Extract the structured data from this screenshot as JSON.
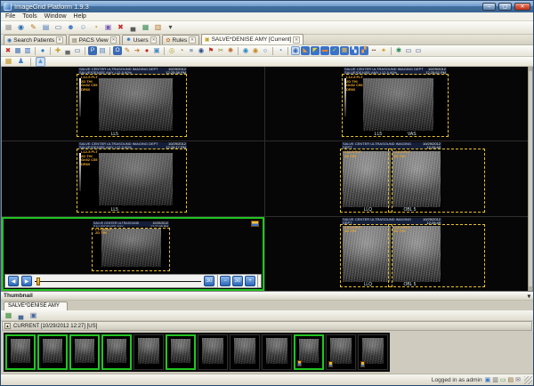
{
  "window": {
    "title": "ImageGrid Platform 1.9.3",
    "minimize": "–",
    "maximize": "▢",
    "close": "✕"
  },
  "menu": {
    "items": [
      {
        "name": "menu-file",
        "label": "File"
      },
      {
        "name": "menu-tools",
        "label": "Tools"
      },
      {
        "name": "menu-window",
        "label": "Window"
      },
      {
        "name": "menu-help",
        "label": "Help"
      }
    ]
  },
  "toolbar_main": {
    "icons": [
      {
        "name": "select-icon",
        "glyph": "▦",
        "color": "#9a9a9a"
      },
      {
        "name": "search-patients-icon",
        "glyph": "◉",
        "color": "#2a6db5"
      },
      {
        "name": "edit-study-icon",
        "glyph": "✎",
        "color": "#b07818"
      },
      {
        "name": "import-study-icon",
        "glyph": "▤",
        "color": "#4a7ab5"
      },
      {
        "name": "pacs-monitor-icon",
        "glyph": "▭",
        "color": "#3a5a8a"
      },
      {
        "name": "user-group-icon",
        "glyph": "☻",
        "color": "#3a76c4"
      },
      {
        "name": "user-icon",
        "glyph": "☺",
        "color": "#6a9ad4"
      },
      {
        "name": "query-retrieve-icon",
        "glyph": "◔",
        "color": "#b5902a"
      },
      {
        "name": "archive-icon",
        "glyph": "▣",
        "color": "#7a5ab5"
      },
      {
        "name": "delete-icon",
        "glyph": "✖",
        "color": "#c42a2a"
      },
      {
        "name": "print-icon",
        "glyph": "▄",
        "color": "#5a5a5a"
      },
      {
        "name": "film-icon",
        "glyph": "▦",
        "color": "#3a8a5a"
      },
      {
        "name": "export-db-icon",
        "glyph": "▥",
        "color": "#b5762a"
      },
      {
        "name": "dropdown-caret-icon",
        "glyph": "▾",
        "color": "#444444"
      }
    ]
  },
  "tabs": {
    "close_glyph": "✕",
    "items": [
      {
        "name": "tab-search-patients",
        "label": "Search Patients",
        "glyph": "◉",
        "color": "#2a6db5"
      },
      {
        "name": "tab-pacs-view",
        "label": "PACS View",
        "glyph": "▤",
        "color": "#7a6a4a"
      },
      {
        "name": "tab-users",
        "label": "Users",
        "glyph": "☻",
        "color": "#3a76c4"
      },
      {
        "name": "tab-rules",
        "label": "Rules",
        "glyph": "✿",
        "color": "#c4702a"
      },
      {
        "name": "tab-study-salve-denise-amy",
        "label": "SALVE*DENISE AMY [Current]",
        "glyph": "▣",
        "color": "#c4a02a",
        "active": true
      }
    ]
  },
  "toolbar_view": {
    "icons": [
      {
        "name": "close-study-icon",
        "glyph": "✖",
        "color": "#c42a2a"
      },
      {
        "name": "layout-grid-icon",
        "glyph": "▦",
        "color": "#3a6ab4"
      },
      {
        "name": "layout-compare-icon",
        "glyph": "▥",
        "color": "#3a6ab4"
      },
      {
        "sep": true
      },
      {
        "name": "sphere-view-icon",
        "glyph": "●",
        "color": "#2a7ac4"
      },
      {
        "sep": true
      },
      {
        "name": "calibrate-icon",
        "glyph": "✚",
        "color": "#c4a02a"
      },
      {
        "name": "print-image-icon",
        "glyph": "▄",
        "color": "#6a6a6a"
      },
      {
        "name": "film-composer-icon",
        "glyph": "▭",
        "color": "#4a6a9a"
      },
      {
        "sep": true
      },
      {
        "name": "tag-p-icon",
        "glyph": "P",
        "color": "#ffffff",
        "bg": "#3a6ab4"
      },
      {
        "name": "page-icon",
        "glyph": "▤",
        "color": "#4a7ab5"
      },
      {
        "sep": true
      },
      {
        "name": "tag-o-icon",
        "glyph": "O",
        "color": "#ffffff",
        "bg": "#3a6ab4"
      },
      {
        "name": "annotate-icon",
        "glyph": "✎",
        "color": "#b07818"
      },
      {
        "name": "send-study-icon",
        "glyph": "➔",
        "color": "#c4701a"
      },
      {
        "name": "record-icon",
        "glyph": "●",
        "color": "#cc2222"
      },
      {
        "name": "copy-icon",
        "glyph": "▣",
        "color": "#4a8ac4"
      },
      {
        "sep": true
      },
      {
        "name": "burn-cd-icon",
        "glyph": "◎",
        "color": "#b5a02a"
      },
      {
        "name": "history-icon",
        "glyph": "◔",
        "color": "#8a7a2a"
      },
      {
        "name": "layers-icon",
        "glyph": "≡",
        "color": "#4a6a9a"
      },
      {
        "name": "find-icon",
        "glyph": "◉",
        "color": "#2a4a8a"
      },
      {
        "name": "flag-icon",
        "glyph": "⚑",
        "color": "#c42a2a"
      },
      {
        "name": "measure-icon",
        "glyph": "✂",
        "color": "#8a8a2a"
      },
      {
        "name": "palette-icon",
        "glyph": "✺",
        "color": "#c46a2a"
      },
      {
        "sep": true
      },
      {
        "name": "web-icon",
        "glyph": "◉",
        "color": "#2a8ac4"
      },
      {
        "name": "web-settings-icon",
        "glyph": "◉",
        "color": "#c48a2a"
      },
      {
        "name": "zoom-icon",
        "glyph": "○",
        "color": "#3a6ab4"
      },
      {
        "sep": true
      },
      {
        "name": "world-clock-icon",
        "glyph": "◔",
        "color": "#2a8ac4"
      },
      {
        "sep": true
      },
      {
        "name": "magnify-mode-icon",
        "glyph": "◉",
        "color": "#3a6ab4",
        "pressed": true
      },
      {
        "name": "preset-layout-1-icon",
        "glyph": "◣",
        "color": "#e8a23a",
        "bg": "#3a72c8"
      },
      {
        "name": "preset-layout-2-icon",
        "glyph": "◤",
        "color": "#e8d43a",
        "bg": "#3a72c8"
      },
      {
        "name": "preset-layout-3-icon",
        "glyph": "▬",
        "color": "#e8832a",
        "bg": "#3a72c8"
      },
      {
        "name": "preset-layout-4-icon",
        "glyph": "✓",
        "color": "#aef05a",
        "bg": "#3a72c8"
      },
      {
        "name": "preset-layout-5-icon",
        "glyph": "▦",
        "color": "#f0c04a",
        "bg": "#3a72c8"
      },
      {
        "name": "preset-layout-6-icon",
        "glyph": "▚",
        "color": "#f0f0f0",
        "bg": "#3a72c8"
      },
      {
        "name": "preset-layout-7-icon",
        "glyph": "▞",
        "color": "#f0a04a",
        "bg": "#3a72c8"
      },
      {
        "name": "ruler-icon",
        "glyph": "┅",
        "color": "#7a4a2a"
      },
      {
        "name": "key-icon",
        "glyph": "✦",
        "color": "#d4a02a"
      },
      {
        "sep": true
      },
      {
        "name": "tools-icon",
        "glyph": "✱",
        "color": "#2a8a5a"
      },
      {
        "name": "monitor-a-icon",
        "glyph": "▭",
        "color": "#4a6a9a"
      },
      {
        "name": "monitor-b-icon",
        "glyph": "▭",
        "color": "#4a6a9a"
      }
    ]
  },
  "toolbar_sub": {
    "icons": [
      {
        "name": "grid-tool-icon",
        "glyph": "▦",
        "color": "#c49a2a"
      },
      {
        "name": "stamp-tool-icon",
        "glyph": "♟",
        "color": "#3a7ac4"
      },
      {
        "sep": true
      },
      {
        "name": "prism-tool-icon",
        "glyph": "▲",
        "color": "#5a9ac4",
        "pressed": true
      }
    ]
  },
  "viewer": {
    "panels": [
      {
        "banner_left": "SALVE CENTER ULTRASOUND  IMAGING DEPT\nSALVE*DENISE AMY  L12-5  60%",
        "banner_right": "10/29/2012\n12:25:38 PM",
        "overlay": "L12-5 PLT\n2D THI\nGn52 C55\nDR60",
        "label": "LL5",
        "label2": ""
      },
      {
        "banner_left": "SALVE CENTER ULTRASOUND  IMAGING DEPT\nSALVE*DENISE AMY  L12-5  60%",
        "banner_right": "10/29/2012\n12:25:52 PM",
        "overlay": "L12-5 PLT\n2D THI\nGn52 C55\nDR60",
        "label": "LL5",
        "label2": "VAS"
      },
      {
        "banner_left": "SALVE CENTER ULTRASOUND  IMAGING DEPT\nSALVE*DENISE AMY  L12-5  60%",
        "banner_right": "10/29/2012\n12:26:17 PM",
        "overlay": "L12-5 PLT\n2D THI\nGn52 C55\nDR60",
        "label": "LL5",
        "label2": ""
      },
      {
        "banner_left": "SALVE CENTER ULTRASOUND  IMAGING DEPT\nSALVE*DENISE AMY  L12-5  60%",
        "banner_right": "10/29/2012\n12:26:40 PM",
        "overlay": "L12-5 PLT\n2D THI",
        "overlay2": "L12-5 PLT\n2D THI",
        "label": "LLQ",
        "label2": "OBL 5"
      },
      {
        "banner_left": "SALVE CENTER ULTRASOUND\nSALVE*DENISE AMY",
        "banner_right": "10/29/2012\n12:27:05 PM",
        "overlay": "L12-5 PLT\n2D THI",
        "label": "",
        "label2": ""
      },
      {
        "banner_left": "SALVE CENTER ULTRASOUND  IMAGING DEPT\nSALVE*DENISE AMY  L12-5  60%",
        "banner_right": "10/29/2012\n12:26:49 PM",
        "overlay": "L12-5 PLT\n2D THI",
        "overlay2": "L12-5 PLT\n2D THI",
        "label": "LLQ",
        "label2": "OBL 5"
      }
    ],
    "player": {
      "prev": "◀",
      "play": "▶",
      "fps": "30",
      "minus": "−",
      "fps2": "30",
      "plus": "+"
    }
  },
  "thumbnail_panel": {
    "title": "Thumbnail",
    "collapse_glyph": "▾",
    "tab": "SALVE*DENISE AMY",
    "toolbar_icons": [
      {
        "name": "thumb-matrix-icon",
        "glyph": "▦",
        "color": "#3a8a3a"
      },
      {
        "name": "thumb-print-icon",
        "glyph": "▄",
        "color": "#4a6a9a"
      },
      {
        "name": "thumb-copy-icon",
        "glyph": "▣",
        "color": "#4a6a9a"
      }
    ],
    "series_collapse_glyph": "▴",
    "series_header": "CURRENT [10/29/2012 12:27] [US]",
    "thumbnails": [
      {
        "name": "thumbnail-1",
        "selected": true
      },
      {
        "name": "thumbnail-2",
        "selected": true
      },
      {
        "name": "thumbnail-3",
        "selected": true
      },
      {
        "name": "thumbnail-4",
        "selected": true
      },
      {
        "name": "thumbnail-5",
        "selected": false
      },
      {
        "name": "thumbnail-6",
        "selected": true
      },
      {
        "name": "thumbnail-7",
        "selected": false
      },
      {
        "name": "thumbnail-8",
        "selected": false
      },
      {
        "name": "thumbnail-9",
        "selected": false
      },
      {
        "name": "thumbnail-10",
        "selected": true,
        "cine": true
      },
      {
        "name": "thumbnail-11",
        "selected": false,
        "cine": true
      },
      {
        "name": "thumbnail-12",
        "selected": false,
        "cine": true
      }
    ]
  },
  "status_bar": {
    "text": "Logged in as admin",
    "icons": [
      {
        "name": "status-network-icon",
        "glyph": "▣",
        "color": "#3a76c4"
      },
      {
        "name": "status-disk-icon",
        "glyph": "▥",
        "color": "#6a6a6a"
      },
      {
        "name": "status-monitor-icon",
        "glyph": "▭",
        "color": "#4a8a4a"
      },
      {
        "name": "status-archive-icon",
        "glyph": "▤",
        "color": "#8a6a3a"
      },
      {
        "name": "status-mail-icon",
        "glyph": "✉",
        "color": "#6a6a8a"
      }
    ]
  }
}
